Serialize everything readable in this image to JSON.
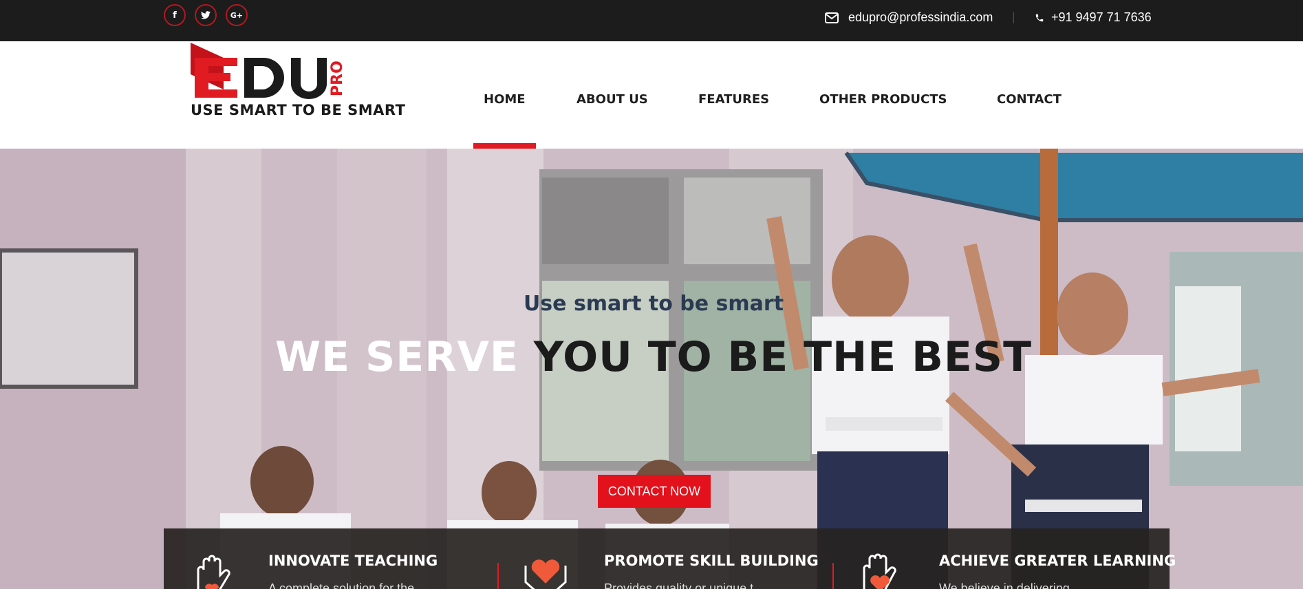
{
  "topbar": {
    "social": [
      {
        "icon": "facebook-icon",
        "glyph": "f"
      },
      {
        "icon": "twitter-icon",
        "glyph": "t"
      },
      {
        "icon": "google-plus-icon",
        "glyph": "G+"
      }
    ],
    "email": "edupro@professindia.com",
    "phone": "+91 9497 71 7636"
  },
  "logo": {
    "main": "EDU",
    "suffix": "PRO",
    "tagline": "USE SMART TO BE SMART"
  },
  "nav": {
    "items": [
      "HOME",
      "ABOUT US",
      "FEATURES",
      "OTHER PRODUCTS",
      "CONTACT"
    ],
    "active": "HOME"
  },
  "hero": {
    "subtitle": "Use smart to be smart",
    "title_part1": "WE SERVE ",
    "title_part2": "YOU TO BE THE BEST",
    "button": "CONTACT NOW"
  },
  "features": [
    {
      "icon": "hand-icon",
      "title": "INNOVATE TEACHING",
      "text": "A complete solution for the"
    },
    {
      "icon": "heart-hands-icon",
      "title": "PROMOTE SKILL BUILDING",
      "text": "Provides quality or unique t"
    },
    {
      "icon": "heart-hand-icon",
      "title": "ACHIEVE GREATER LEARNING",
      "text": "We believe in delivering"
    }
  ],
  "colors": {
    "accent": "#e01b22",
    "topbar": "#1c1c1c",
    "heading": "#2b3a52"
  }
}
